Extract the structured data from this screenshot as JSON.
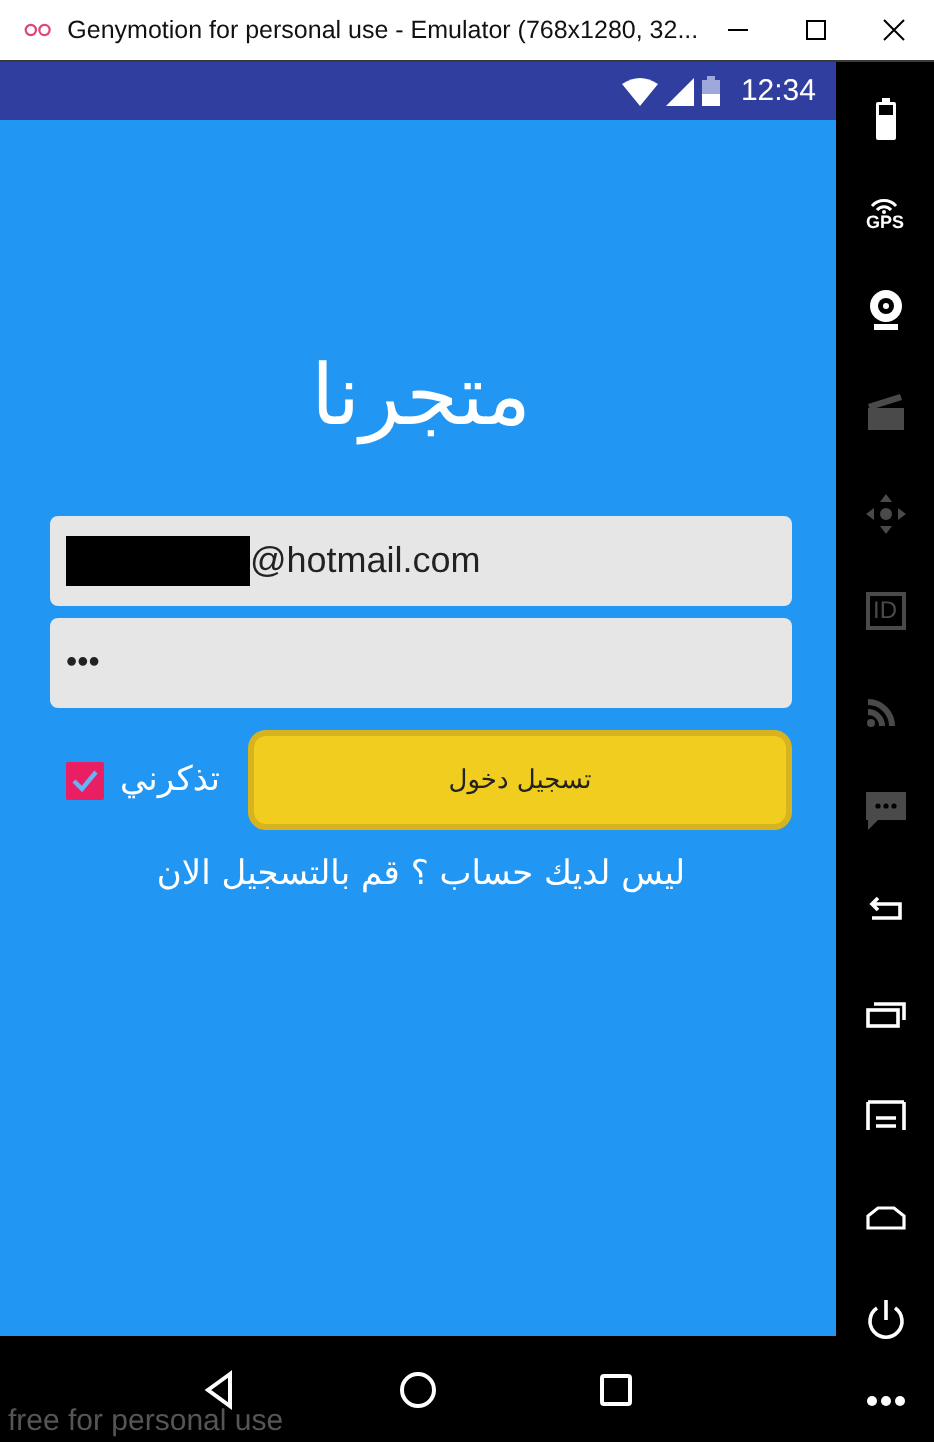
{
  "window": {
    "title": "Genymotion for personal use - Emulator (768x1280, 32..."
  },
  "status_bar": {
    "time": "12:34"
  },
  "app": {
    "title": "متجرنا",
    "email": {
      "value": "@hotmail.com",
      "redacted": true
    },
    "password": {
      "value": "•••"
    },
    "remember": {
      "label": "تذكرني",
      "checked": true
    },
    "login_button": "تسجيل دخول",
    "signup_link": "ليس لديك حساب ؟ قم بالتسجيل الان"
  },
  "sidebar": [
    {
      "kind": "battery",
      "disabled": false
    },
    {
      "kind": "gps",
      "label": "GPS",
      "disabled": false
    },
    {
      "kind": "webcam",
      "disabled": false
    },
    {
      "kind": "clapper",
      "disabled": true
    },
    {
      "kind": "dpad",
      "disabled": true
    },
    {
      "kind": "id",
      "label": "ID",
      "disabled": true
    },
    {
      "kind": "rss",
      "disabled": true
    },
    {
      "kind": "sms",
      "disabled": true
    },
    {
      "kind": "back",
      "disabled": false
    },
    {
      "kind": "recent",
      "disabled": false
    },
    {
      "kind": "menu",
      "disabled": false
    },
    {
      "kind": "home",
      "disabled": false
    },
    {
      "kind": "power",
      "disabled": false
    },
    {
      "kind": "more",
      "disabled": false
    }
  ],
  "nav_bar": [
    {
      "kind": "back"
    },
    {
      "kind": "home"
    },
    {
      "kind": "recent"
    }
  ],
  "notice": "free for personal use"
}
